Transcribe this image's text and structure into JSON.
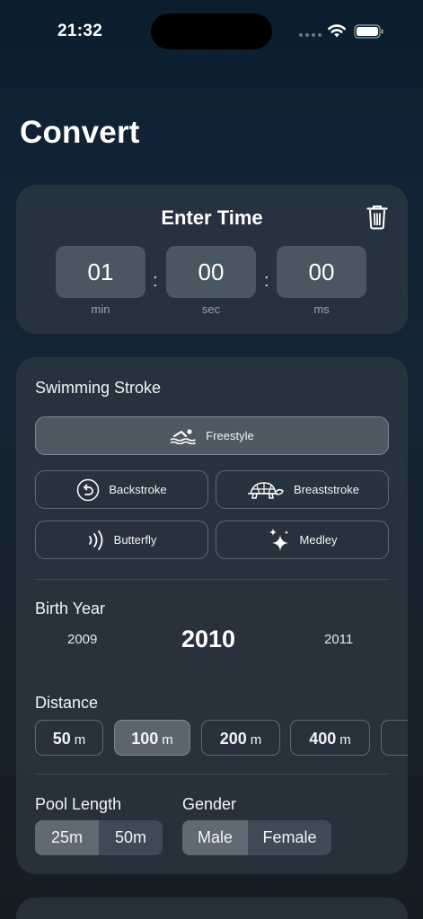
{
  "status_bar": {
    "time": "21:32"
  },
  "page": {
    "title": "Convert"
  },
  "time_card": {
    "title": "Enter Time",
    "fields": [
      {
        "value": "01",
        "unit": "min"
      },
      {
        "value": "00",
        "unit": "sec"
      },
      {
        "value": "00",
        "unit": "ms"
      }
    ],
    "separator": ":"
  },
  "stroke": {
    "label": "Swimming Stroke",
    "selected": "Freestyle",
    "options": [
      {
        "label": "Freestyle",
        "icon": "swimmer-icon"
      },
      {
        "label": "Backstroke",
        "icon": "circular-arrow-icon"
      },
      {
        "label": "Breaststroke",
        "icon": "turtle-icon"
      },
      {
        "label": "Butterfly",
        "icon": "wave-arcs-icon"
      },
      {
        "label": "Medley",
        "icon": "sparkles-icon"
      }
    ]
  },
  "birth_year": {
    "label": "Birth Year",
    "prev": "2009",
    "selected": "2010",
    "next": "2011"
  },
  "distance": {
    "label": "Distance",
    "selected": "100",
    "unit": "m",
    "options": [
      "50",
      "100",
      "200",
      "400"
    ]
  },
  "pool_length": {
    "label": "Pool Length",
    "selected": "25m",
    "options": [
      "25m",
      "50m"
    ]
  },
  "gender": {
    "label": "Gender",
    "selected": "Male",
    "options": [
      "Male",
      "Female"
    ]
  },
  "colors": {
    "background_top": "#0b1d2c",
    "card": "#2e3944",
    "selected_fill": "#4d5963",
    "border": "#5d6a76"
  }
}
